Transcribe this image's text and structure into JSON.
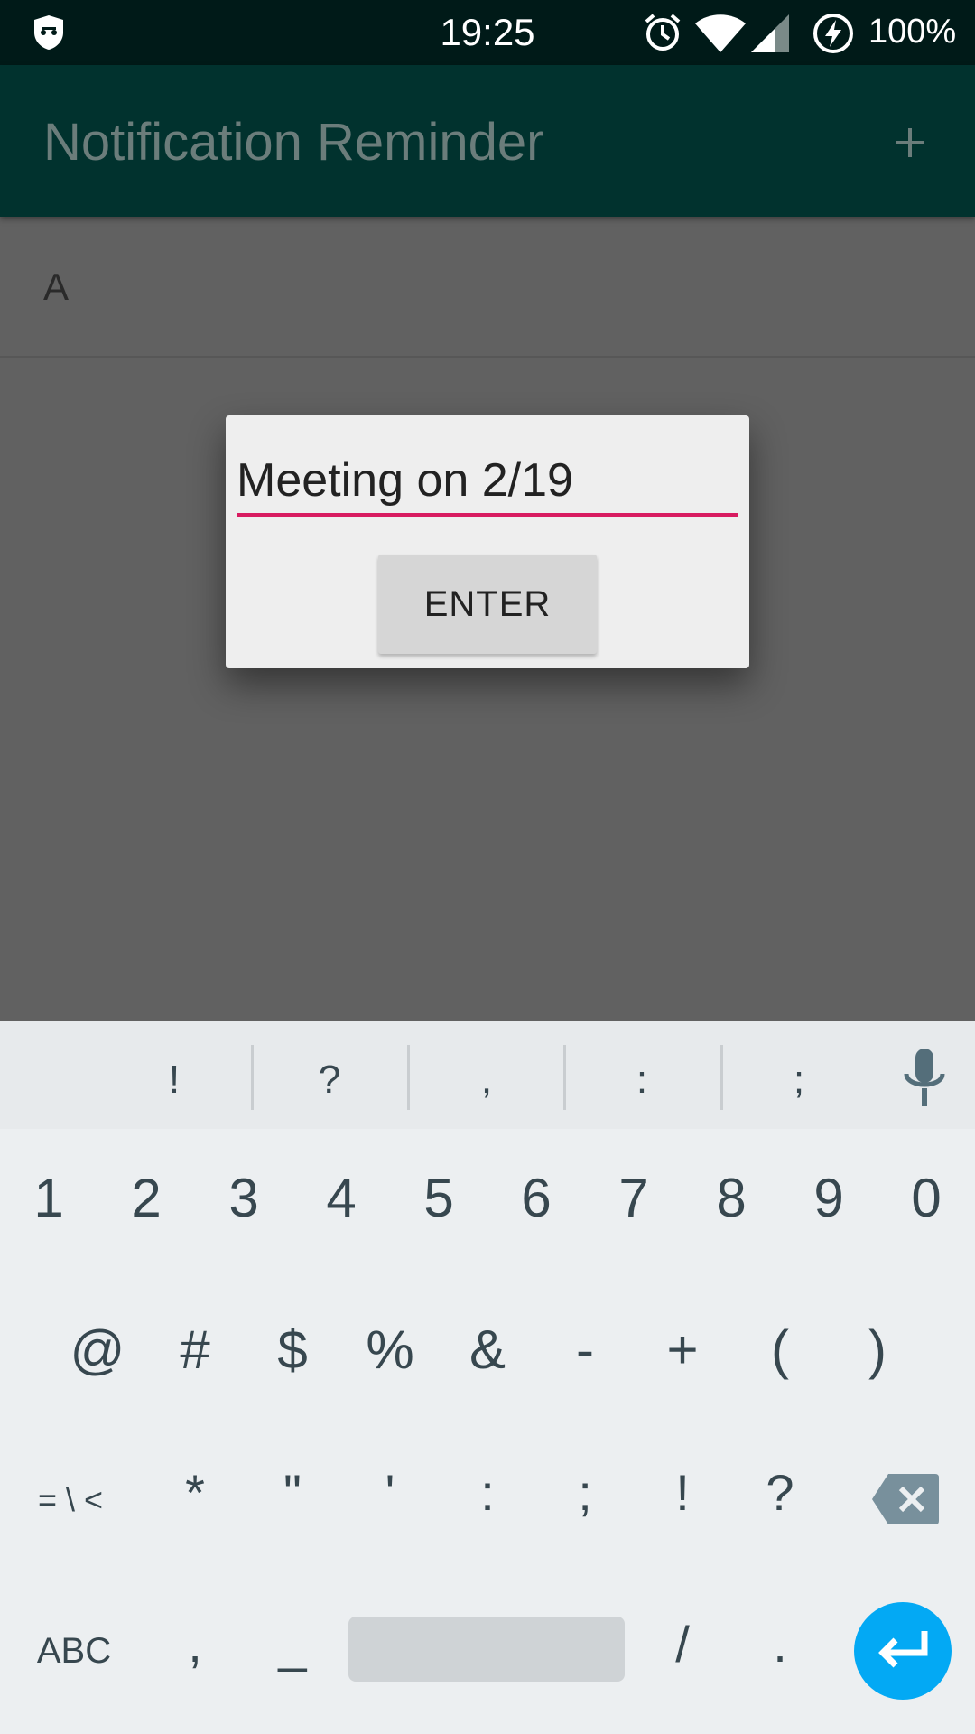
{
  "status_bar": {
    "time": "19:25",
    "battery": "100%",
    "icons": [
      "shield-icon",
      "alarm-icon",
      "wifi-icon",
      "signal-icon",
      "charging-icon"
    ]
  },
  "app_bar": {
    "title": "Notification Reminder",
    "add_icon": "+",
    "background_color": "#01322e"
  },
  "list": {
    "items": [
      {
        "label": "A"
      }
    ]
  },
  "dialog": {
    "input_value": "Meeting on 2/19",
    "accent_color": "#d81b60",
    "enter_label": "ENTER"
  },
  "keyboard": {
    "suggestions": [
      "!",
      "?",
      ",",
      ":",
      ";"
    ],
    "row1": [
      "1",
      "2",
      "3",
      "4",
      "5",
      "6",
      "7",
      "8",
      "9",
      "0"
    ],
    "row2": [
      "@",
      "#",
      "$",
      "%",
      "&",
      "-",
      "+",
      "(",
      ")"
    ],
    "row3": [
      "= \\ <",
      "*",
      "\"",
      "'",
      ":",
      ";",
      "!",
      "?"
    ],
    "row4": [
      "ABC",
      ",",
      "_",
      "/",
      "."
    ],
    "enter_color": "#03a9f4"
  }
}
